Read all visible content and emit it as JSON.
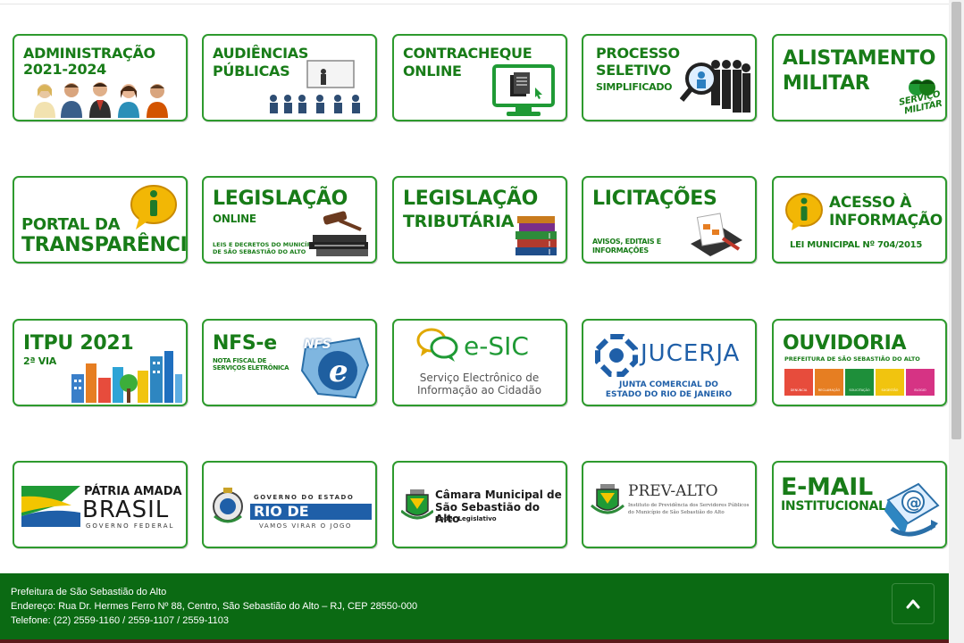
{
  "cards": {
    "administracao": {
      "line1": "ADMINISTRAÇÃO",
      "line2": "2021-2024"
    },
    "audiencias": {
      "line1": "AUDIÊNCIAS",
      "line2": "PÚBLICAS"
    },
    "contracheque": {
      "line1": "CONTRACHEQUE",
      "line2": "ONLINE"
    },
    "processo": {
      "line1": "PROCESSO",
      "line2": "SELETIVO",
      "line3": "SIMPLIFICADO"
    },
    "alistamento": {
      "line1": "ALISTAMENTO",
      "line2": "MILITAR",
      "badge1": "SERVIÇO",
      "badge2": "MILITAR"
    },
    "portal": {
      "line1": "PORTAL DA",
      "line2": "TRANSPARÊNCIA"
    },
    "legislacao_online": {
      "line1": "LEGISLAÇÃO",
      "line2": "ONLINE",
      "line3": "LEIS E DECRETOS DO MUNICÍPIO",
      "line4": "DE SÃO SEBASTIÃO DO ALTO"
    },
    "legislacao_tributaria": {
      "line1": "LEGISLAÇÃO",
      "line2": "TRIBUTÁRIA"
    },
    "licitacoes": {
      "line1": "LICITAÇÕES",
      "line2": "AVISOS, EDITAIS E",
      "line3": "INFORMAÇÕES"
    },
    "acesso": {
      "line1": "ACESSO À",
      "line2": "INFORMAÇÃO",
      "line3": "LEI MUNICIPAL Nº 704/2015"
    },
    "itpu": {
      "line1": "ITPU 2021",
      "line2": "2ª VIA"
    },
    "nfse": {
      "line1": "NFS-e",
      "line2": "NOTA FISCAL DE",
      "line3": "SERVIÇOS ELETRÔNICA",
      "logo": "NFS"
    },
    "esic": {
      "logo": "e-SIC",
      "line1": "Serviço Electrônico de",
      "line2": "Informação ao Cidadão"
    },
    "jucerja": {
      "logo": "JUCERJA",
      "line1": "JUNTA COMERCIAL DO",
      "line2": "ESTADO DO RIO DE JANEIRO"
    },
    "ouvidoria": {
      "line1": "OUVIDORIA",
      "line2": "PREFEITURA DE SÃO SEBASTIÃO DO ALTO",
      "options": [
        "DENÚNCIA",
        "RECLAMAÇÃO",
        "SOLICITAÇÃO",
        "SUGESTÃO",
        "ELOGIO"
      ]
    },
    "patria": {
      "line1": "PÁTRIA AMADA",
      "line2": "BRASIL",
      "line3": "GOVERNO FEDERAL"
    },
    "rj": {
      "line1": "GOVERNO DO ESTADO",
      "line2": "RIO DE JANEIRO",
      "line3": "VAMOS VIRAR O JOGO"
    },
    "camara": {
      "line1": "Câmara Municipal de",
      "line2": "São Sebastião do Alto",
      "line3": "Poder Legislativo"
    },
    "prev": {
      "line1": "PREV-ALTO",
      "line2": "Instituto de Previdência dos Servidores Públicos",
      "line3": "do Município de São Sebastião do Alto"
    },
    "email": {
      "line1": "E-MAIL",
      "line2": "INSTITUCIONAL"
    }
  },
  "footer": {
    "name": "Prefeitura de São Sebastião do Alto",
    "address": "Endereço: Rua Dr. Hermes Ferro Nº 88, Centro, São Sebastião do Alto – RJ, CEP 28550-000",
    "phone": "Telefone: (22) 2559-1160 / 2559-1107 / 2559-1103"
  },
  "colors": {
    "green": "#187c18",
    "border": "#2e9a2e",
    "footer": "#0b6a13"
  },
  "icons": {
    "back_to_top": "chevron-up-icon"
  }
}
